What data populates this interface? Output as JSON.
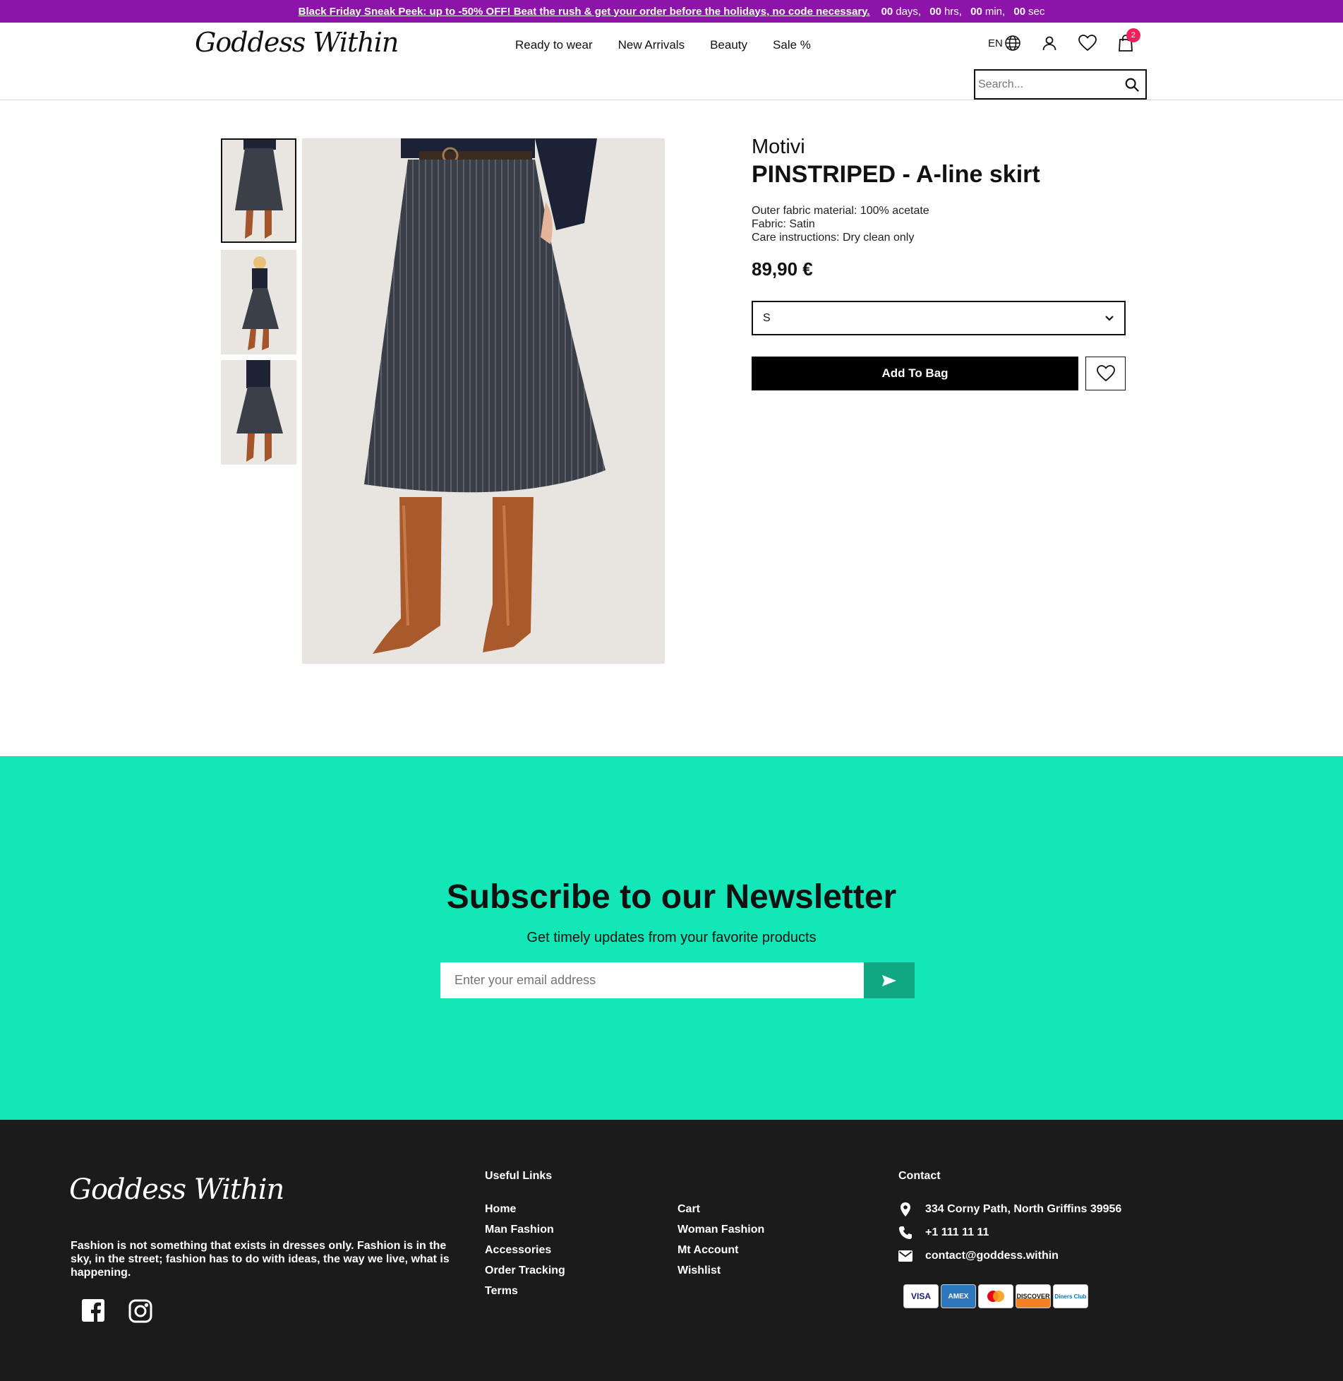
{
  "promo": {
    "link_text": "Black Friday Sneak Peek: up to -50% OFF! Beat the rush & get your order before the holidays, no code necessary.",
    "countdown": {
      "days": "00",
      "days_unit": "days,",
      "hrs": "00",
      "hrs_unit": "hrs,",
      "min": "00",
      "min_unit": "min,",
      "sec": "00",
      "sec_unit": "sec"
    }
  },
  "header": {
    "logo": "Goddess Within",
    "nav": [
      "Ready to wear",
      "New Arrivals",
      "Beauty",
      "Sale %"
    ],
    "lang": "EN",
    "cart_count": "2",
    "search_placeholder": "Search..."
  },
  "product": {
    "brand": "Motivi",
    "title": "PINSTRIPED - A-line skirt",
    "specs": [
      "Outer fabric material: 100% acetate",
      "Fabric: Satin",
      "Care instructions: Dry clean only"
    ],
    "price": "89,90 €",
    "size_selected": "S",
    "add_to_bag": "Add To Bag"
  },
  "newsletter": {
    "title": "Subscribe to our Newsletter",
    "subtitle": "Get timely updates from your favorite products",
    "email_placeholder": "Enter your email address"
  },
  "footer": {
    "logo": "Goddess Within",
    "about": "Fashion is not something that exists in dresses only. Fashion is in the sky, in the street; fashion has to do with ideas, the way we live, what is happening.",
    "useful_links_heading": "Useful Links",
    "links_col1": [
      "Home",
      "Man Fashion",
      "Accessories",
      "Order Tracking",
      "Terms"
    ],
    "links_col2": [
      "Cart",
      "Woman Fashion",
      "Mt Account",
      "Wishlist"
    ],
    "contact_heading": "Contact",
    "address": "334 Corny Path, North Griffins 39956",
    "phone": "+1 111 11 11",
    "email": "contact@goddess.within",
    "payment_cards": [
      "VISA",
      "AMEX",
      "mastercard",
      "DISCOVER",
      "Diners Club"
    ]
  },
  "colors": {
    "promo_bg": "#8c14a8",
    "newsletter_bg": "#13e6b7",
    "newsletter_button": "#0fa882",
    "footer_bg": "#1b1b1b",
    "cart_badge": "#ee1f5b"
  }
}
